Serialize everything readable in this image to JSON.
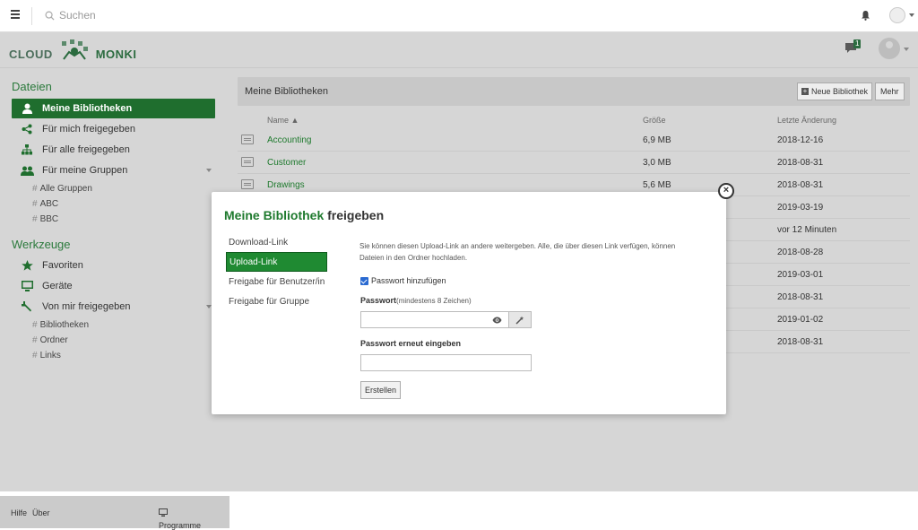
{
  "topbar": {
    "search_placeholder": "Suchen"
  },
  "brand": {
    "left": "CLOUD",
    "right": "MONKI",
    "notification_count": "1",
    "accent": "#1f6e2e"
  },
  "sidebar": {
    "files_title": "Dateien",
    "items": [
      {
        "label": "Meine Bibliotheken",
        "icon": "user-icon",
        "active": true
      },
      {
        "label": "Für mich freigegeben",
        "icon": "share-icon"
      },
      {
        "label": "Für alle freigegeben",
        "icon": "org-icon"
      },
      {
        "label": "Für meine Gruppen",
        "icon": "group-icon"
      }
    ],
    "groups": [
      "Alle Gruppen",
      "ABC",
      "BBC"
    ],
    "tools_title": "Werkzeuge",
    "tools": [
      {
        "label": "Favoriten",
        "icon": "star-icon"
      },
      {
        "label": "Geräte",
        "icon": "monitor-icon"
      },
      {
        "label": "Von mir freigegeben",
        "icon": "wrench-icon"
      }
    ],
    "shared": [
      "Bibliotheken",
      "Ordner",
      "Links"
    ],
    "footer": {
      "help": "Hilfe",
      "about": "Über",
      "programs": "Programme"
    }
  },
  "main": {
    "title": "Meine Bibliotheken",
    "new_button": "Neue Bibliothek",
    "more_button": "Mehr",
    "columns": {
      "name": "Name ▲",
      "size": "Größe",
      "modified": "Letzte Änderung"
    },
    "rows": [
      {
        "name": "Accounting",
        "size": "6,9 MB",
        "date": "2018-12-16"
      },
      {
        "name": "Customer",
        "size": "3,0 MB",
        "date": "2018-08-31"
      },
      {
        "name": "Drawings",
        "size": "5,6 MB",
        "date": "2018-08-31"
      },
      {
        "name": "",
        "size": "",
        "date": "2019-03-19"
      },
      {
        "name": "",
        "size": "",
        "date": "vor 12 Minuten"
      },
      {
        "name": "",
        "size": "",
        "date": "2018-08-28"
      },
      {
        "name": "",
        "size": "",
        "date": "2019-03-01"
      },
      {
        "name": "",
        "size": "",
        "date": "2018-08-31"
      },
      {
        "name": "",
        "size": "",
        "date": "2019-01-02"
      },
      {
        "name": "",
        "size": "",
        "date": "2018-08-31"
      }
    ]
  },
  "modal": {
    "title_lib": "Meine Bibliothek",
    "title_rest": "freigeben",
    "tabs": [
      "Download-Link",
      "Upload-Link",
      "Freigabe für Benutzer/in",
      "Freigabe für Gruppe"
    ],
    "active_tab": 1,
    "description": "Sie können diesen Upload-Link an andere weitergeben. Alle, die über diesen Link verfügen, können Dateien in den Ordner hochladen.",
    "checkbox_label": "Passwort hinzufügen",
    "password_label": "Passwort",
    "password_hint": "(mindestens 8 Zeichen)",
    "password_value": "",
    "password_repeat_label": "Passwort erneut eingeben",
    "password_repeat_value": "",
    "submit": "Erstellen"
  }
}
